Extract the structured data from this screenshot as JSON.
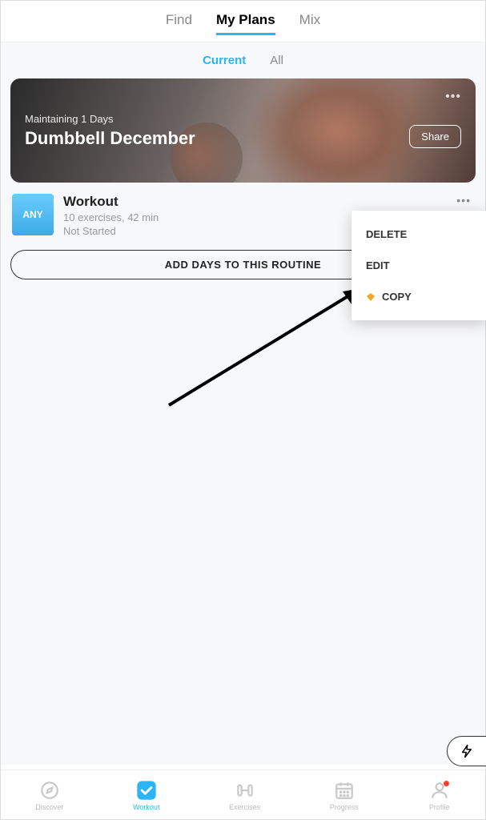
{
  "topTabs": {
    "find": "Find",
    "myPlans": "My Plans",
    "mix": "Mix"
  },
  "subTabs": {
    "current": "Current",
    "all": "All"
  },
  "hero": {
    "maintain": "Maintaining  1 Days",
    "title": "Dumbbell December",
    "share": "Share",
    "more": "•••"
  },
  "workout": {
    "badge": "ANY",
    "title": "Workout",
    "meta": "10 exercises, 42 min",
    "status": "Not Started",
    "more": "•••"
  },
  "addDays": "ADD DAYS TO THIS ROUTINE",
  "contextMenu": {
    "delete": "DELETE",
    "edit": "EDIT",
    "copy": "COPY"
  },
  "nav": {
    "discover": "Discover",
    "workout": "Workout",
    "exercises": "Exercises",
    "progress": "Progress",
    "profile": "Profile"
  }
}
